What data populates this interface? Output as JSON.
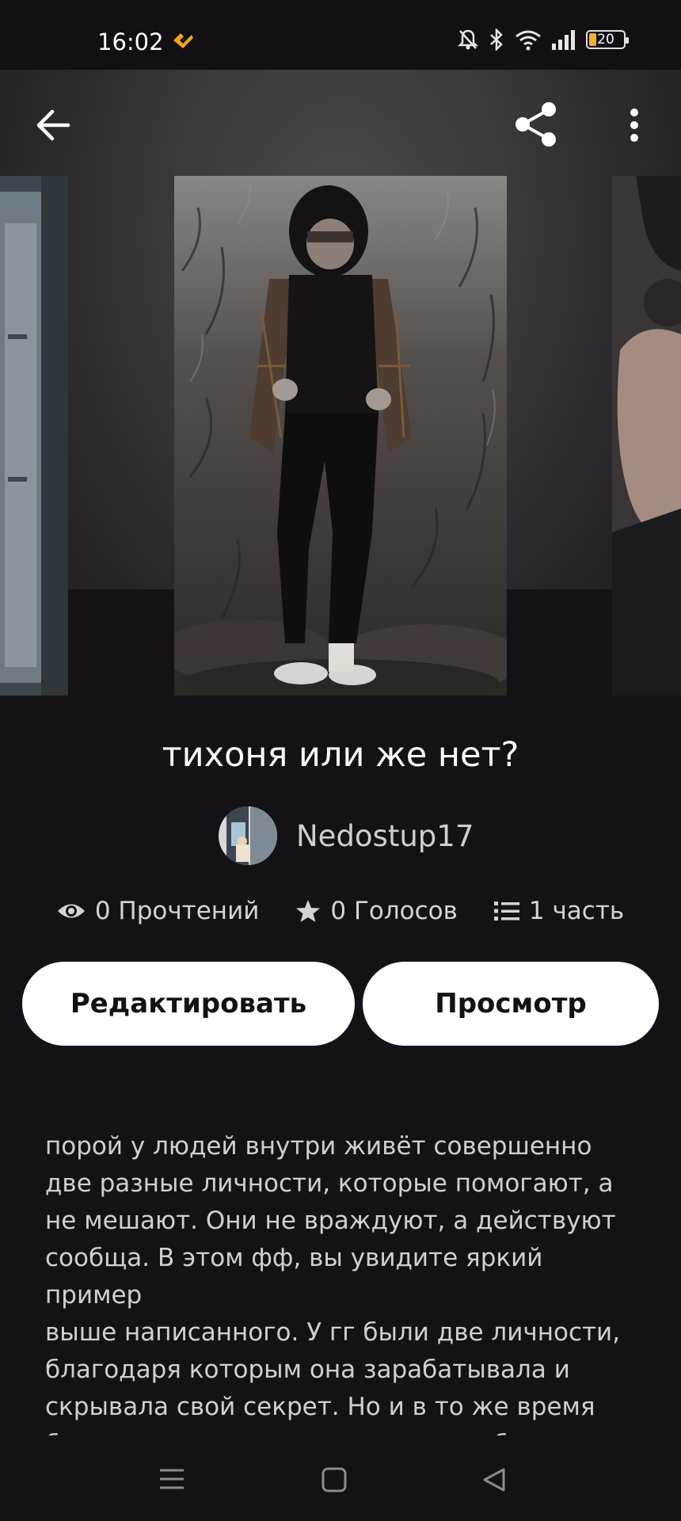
{
  "status_bar": {
    "time": "16:02",
    "battery": "20",
    "icons": [
      "app-notification-icon",
      "mute-icon",
      "bluetooth-icon",
      "wifi-icon",
      "signal-icon",
      "battery-icon"
    ]
  },
  "toolbar": {
    "icons": [
      "back-arrow-icon",
      "share-icon",
      "more-vertical-icon"
    ]
  },
  "story": {
    "title": "тихоня или же нет?",
    "author": "Nedostup17",
    "stats": {
      "reads": "0 Прочтений",
      "votes": "0 Голосов",
      "parts": "1 часть"
    },
    "buttons": {
      "edit": "Редактировать",
      "preview": "Просмотр"
    },
    "description": "порой у людей внутри живёт совершенно\nдве разные личности, которые помогают, а\nне мешают. Они не враждуют, а действуют\nсообща. В этом фф, вы увидите яркий пример\nвыше написанного. У гг были две личности,\nблагодаря которым  она зарабатывала и\nскрывала свой секрет. Но и в то же время\nбыла изгоем, только для того что бы никто не"
  },
  "colors": {
    "background": "#141216",
    "accent": "#f2b230",
    "button_bg": "#ffffff",
    "text_primary": "#ffffff",
    "text_secondary": "#d0d0d0"
  },
  "nav_bar": {
    "icons": [
      "recent-apps-icon",
      "home-icon",
      "back-nav-icon"
    ]
  }
}
